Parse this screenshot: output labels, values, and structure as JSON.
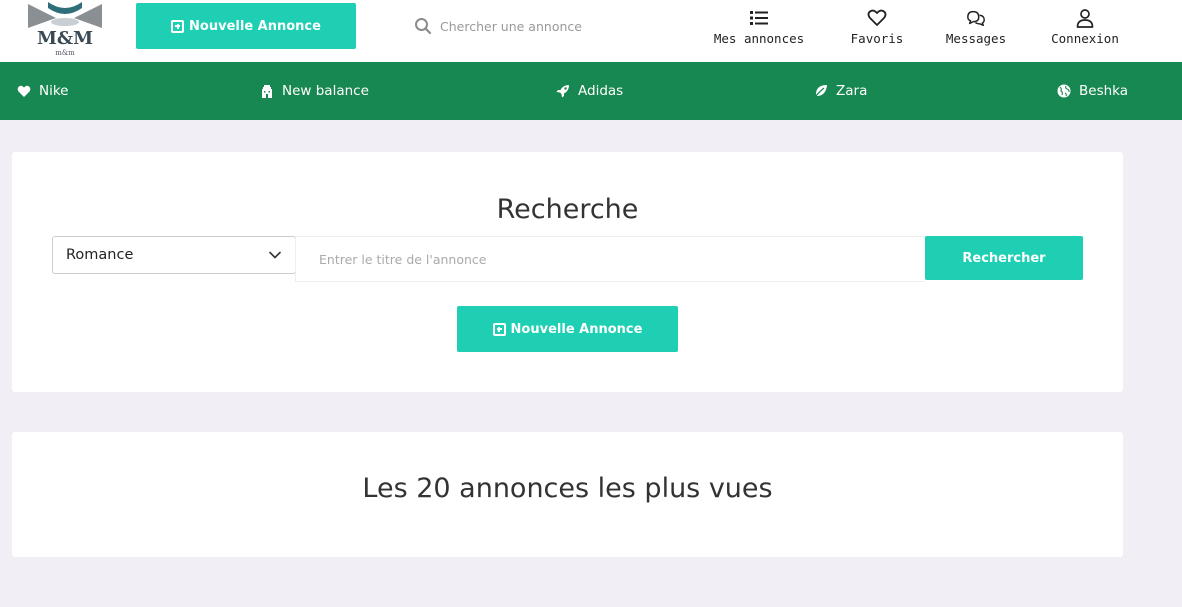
{
  "logo": {
    "text": "M&M",
    "subtext": "m&m"
  },
  "header": {
    "new_ad_label": "Nouvelle Annonce",
    "search_placeholder": "Chercher une annonce",
    "nav": [
      {
        "label": "Mes annonces",
        "icon": "list-icon"
      },
      {
        "label": "Favoris",
        "icon": "heart-icon"
      },
      {
        "label": "Messages",
        "icon": "chat-icon"
      },
      {
        "label": "Connexion",
        "icon": "user-icon"
      }
    ]
  },
  "brands": [
    {
      "label": "Nike",
      "icon": "heart-icon"
    },
    {
      "label": "New balance",
      "icon": "building-icon"
    },
    {
      "label": "Adidas",
      "icon": "rocket-icon"
    },
    {
      "label": "Zara",
      "icon": "leaf-icon"
    },
    {
      "label": "Beshka",
      "icon": "globe-icon"
    }
  ],
  "search_card": {
    "title": "Recherche",
    "select_value": "Romance",
    "input_placeholder": "Entrer le titre de l'annonce",
    "search_button": "Rechercher",
    "new_ad_label": "Nouvelle Annonce"
  },
  "top_card": {
    "title": "Les 20 annonces les plus vues"
  },
  "colors": {
    "accent": "#1ecfb4",
    "brandbar": "#188852",
    "background": "#f1eff5"
  }
}
